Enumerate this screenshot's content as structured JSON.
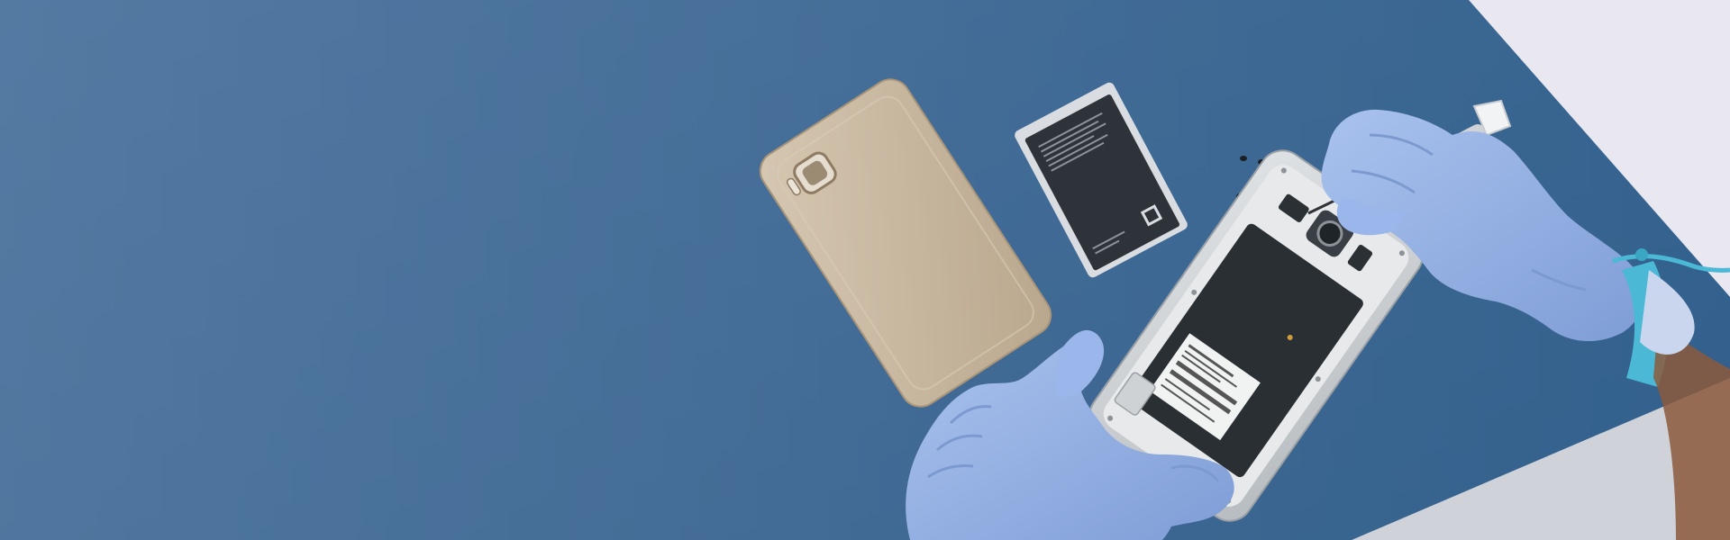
{
  "scene": {
    "description_icons": [
      "phone-back-cover-icon",
      "battery-icon",
      "screws-icon",
      "screwdriver-icon",
      "opened-phone-icon",
      "gloved-hand-icon",
      "antistatic-wrist-strap-icon"
    ],
    "colors": {
      "backdrop_left": "#6f8daf",
      "backdrop_right": "#2f5b86",
      "mat": "#2e5f8c",
      "wall": "#e7e6ef",
      "glove": "#97b5e6",
      "glove_shadow": "#7c9ad0",
      "strap": "#4bb8d6",
      "back_cover": "#cbbba5",
      "battery_body": "#2d3338",
      "battery_rim": "#d9dde2",
      "phone_frame": "#cfd3d6",
      "phone_inner": "#e7e9ea"
    }
  }
}
